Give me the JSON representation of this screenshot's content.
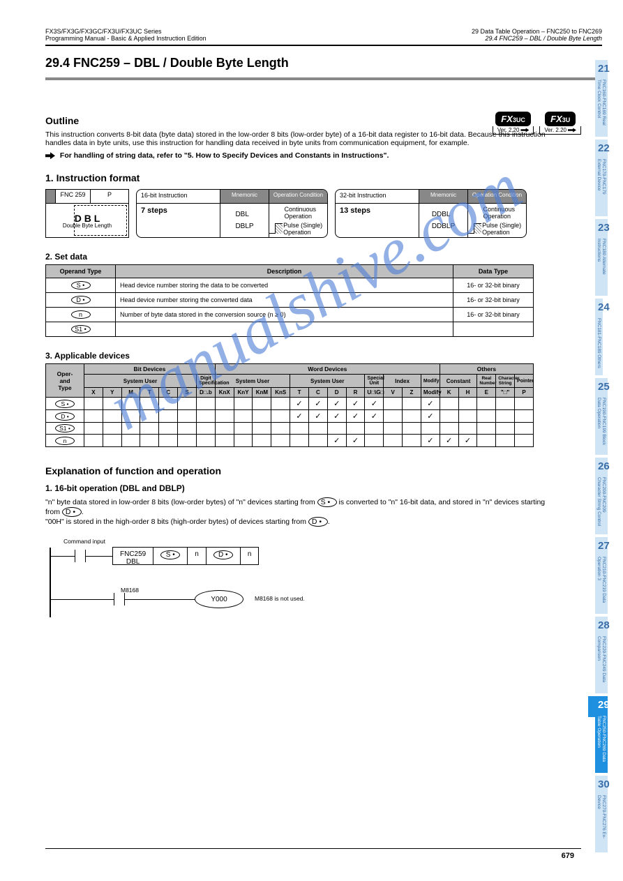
{
  "header": {
    "left_line1": "FX3S/FX3G/FX3GC/FX3U/FX3UC Series",
    "left_line2": "Programming Manual - Basic & Applied Instruction Edition",
    "right_line1": "29 Data Table Operation – FNC250 to FNC269",
    "right_line2": "29.4 FNC259 – DBL / Double Byte Length"
  },
  "section": "29.4  FNC259 – DBL / Double Byte Length",
  "badges": {
    "a_top": "FX3UC",
    "a_bot": "Ver. 2.20",
    "b_top": "FX3U",
    "b_bot": "Ver. 2.20"
  },
  "outline_title": "Outline",
  "outline_p": "This instruction converts 8-bit data (byte data) stored in the low-order 8 bits (low-order byte) of a 16-bit data register to 16-bit data.\nBecause this instruction handles data in byte units, use this instruction for handling data received in byte units from communication equipment, for example.",
  "ref": "For handling of string data, refer to \"5. How to Specify Devices and Constants in Instructions\".",
  "format_title": "1. Instruction format",
  "instbox": {
    "fnc": "FNC 259",
    "mn": "D B L",
    "mn2": "DBL",
    "cap": "Double Byte Length",
    "dcap": "P"
  },
  "ops16": {
    "title": "16-bit Instruction",
    "mn": "Mnemonic",
    "oc": "Operation Condition",
    "items": [
      {
        "name": "DBL",
        "cond": "Continuous Operation"
      },
      {
        "name": "DBLP",
        "cond": "Pulse (Single) Operation"
      }
    ],
    "steps": "7 steps"
  },
  "ops32": {
    "title": "32-bit Instruction",
    "mn": "Mnemonic",
    "oc": "Operation Condition",
    "items": [
      {
        "name": "DDBL",
        "cond": "Continuous Operation"
      },
      {
        "name": "DDBLP",
        "cond": "Pulse (Single) Operation"
      }
    ],
    "steps": "13 steps"
  },
  "operands_title": "2. Set data",
  "operands": {
    "headers": [
      "Operand Type",
      "Description",
      "Data Type"
    ],
    "rows": [
      {
        "op": "S •",
        "desc": "Head device number storing the data to be converted",
        "dt": "16- or 32-bit binary"
      },
      {
        "op": "D •",
        "desc": "Head device number storing the converted data",
        "dt": "16- or 32-bit binary"
      },
      {
        "op": "n",
        "desc": "Number of byte data stored in the conversion source (n ≥ 0)",
        "dt": "16- or 32-bit binary"
      }
    ],
    "extra": "S1 •"
  },
  "applicable_title": "3. Applicable devices",
  "applicable": {
    "group_headers": [
      "Bit Devices",
      "Word Devices",
      "Others"
    ],
    "sub_headers1": [
      "System User",
      "Digit Specification",
      "System User",
      "Special Unit",
      "Index",
      "Constant",
      "Real Number",
      "Character String",
      "Pointer"
    ],
    "cols": [
      "X",
      "Y",
      "M",
      "T",
      "C",
      "S",
      "D□.b",
      "KnX",
      "KnY",
      "KnM",
      "KnS",
      "T",
      "C",
      "D",
      "R",
      "U□\\G□",
      "V",
      "Z",
      "Modify",
      "K",
      "H",
      "E",
      "\"□\"",
      "P"
    ],
    "rows": [
      {
        "label": "S •",
        "checks": [
          0,
          0,
          0,
          0,
          0,
          0,
          0,
          0,
          0,
          0,
          0,
          1,
          1,
          1,
          1,
          1,
          0,
          0,
          1,
          0,
          0,
          0,
          0,
          0
        ]
      },
      {
        "label": "D •",
        "checks": [
          0,
          0,
          0,
          0,
          0,
          0,
          0,
          0,
          0,
          0,
          0,
          1,
          1,
          1,
          1,
          1,
          0,
          0,
          1,
          0,
          0,
          0,
          0,
          0
        ]
      },
      {
        "label": "S1 •",
        "checks": [
          0,
          0,
          0,
          0,
          0,
          0,
          0,
          0,
          0,
          0,
          0,
          0,
          0,
          0,
          0,
          0,
          0,
          0,
          0,
          0,
          0,
          0,
          0,
          0
        ]
      },
      {
        "label": "n",
        "checks": [
          0,
          0,
          0,
          0,
          0,
          0,
          0,
          0,
          0,
          0,
          0,
          0,
          0,
          1,
          1,
          0,
          0,
          0,
          1,
          1,
          1,
          0,
          0,
          0
        ]
      }
    ]
  },
  "expl_title": "Explanation of function and operation",
  "sub16": "1. 16-bit operation (DBL and DBLP)",
  "sub16_p": "\"n\" byte data stored in low-order 8 bits (low-order bytes) of \"n\" devices starting from  S  is converted to \"n\" 16-bit data, and stored in \"n\" devices starting from  D .\n\"00H\" is stored in the high-order 8 bits (high-order bytes) of devices starting from  D .",
  "ladder": {
    "cmd_label": "Command input",
    "fnc": "FNC259",
    "mn": "DBL",
    "s": "S •",
    "d": "D •",
    "n": "n",
    "coil": "Y000",
    "m8168": "M8168",
    "note": "M8168 is not used."
  },
  "tabs": [
    {
      "num": "21",
      "txt": "FNC160-FNC169 Real Time Clock Control"
    },
    {
      "num": "22",
      "txt": "FNC170-FNC179 External Device"
    },
    {
      "num": "23",
      "txt": "FNC180 Alternate Instructions"
    },
    {
      "num": "24",
      "txt": "FNC181-FNC189 Others"
    },
    {
      "num": "25",
      "txt": "FNC190-FNC199 Block Data Operation"
    },
    {
      "num": "26",
      "txt": "FNC200-FNC209 Character String Control"
    },
    {
      "num": "27",
      "txt": "FNC210-FNC219 Data Operation 3"
    },
    {
      "num": "28",
      "txt": "FNC220-FNC249 Data Comparison"
    },
    {
      "num": "29",
      "txt": "FNC250-FNC269 Data Table Operation",
      "active": true
    },
    {
      "num": "30",
      "txt": "FNC270-FNC276 Ex-Device"
    }
  ],
  "page": "679",
  "watermark": "manualshive.com"
}
